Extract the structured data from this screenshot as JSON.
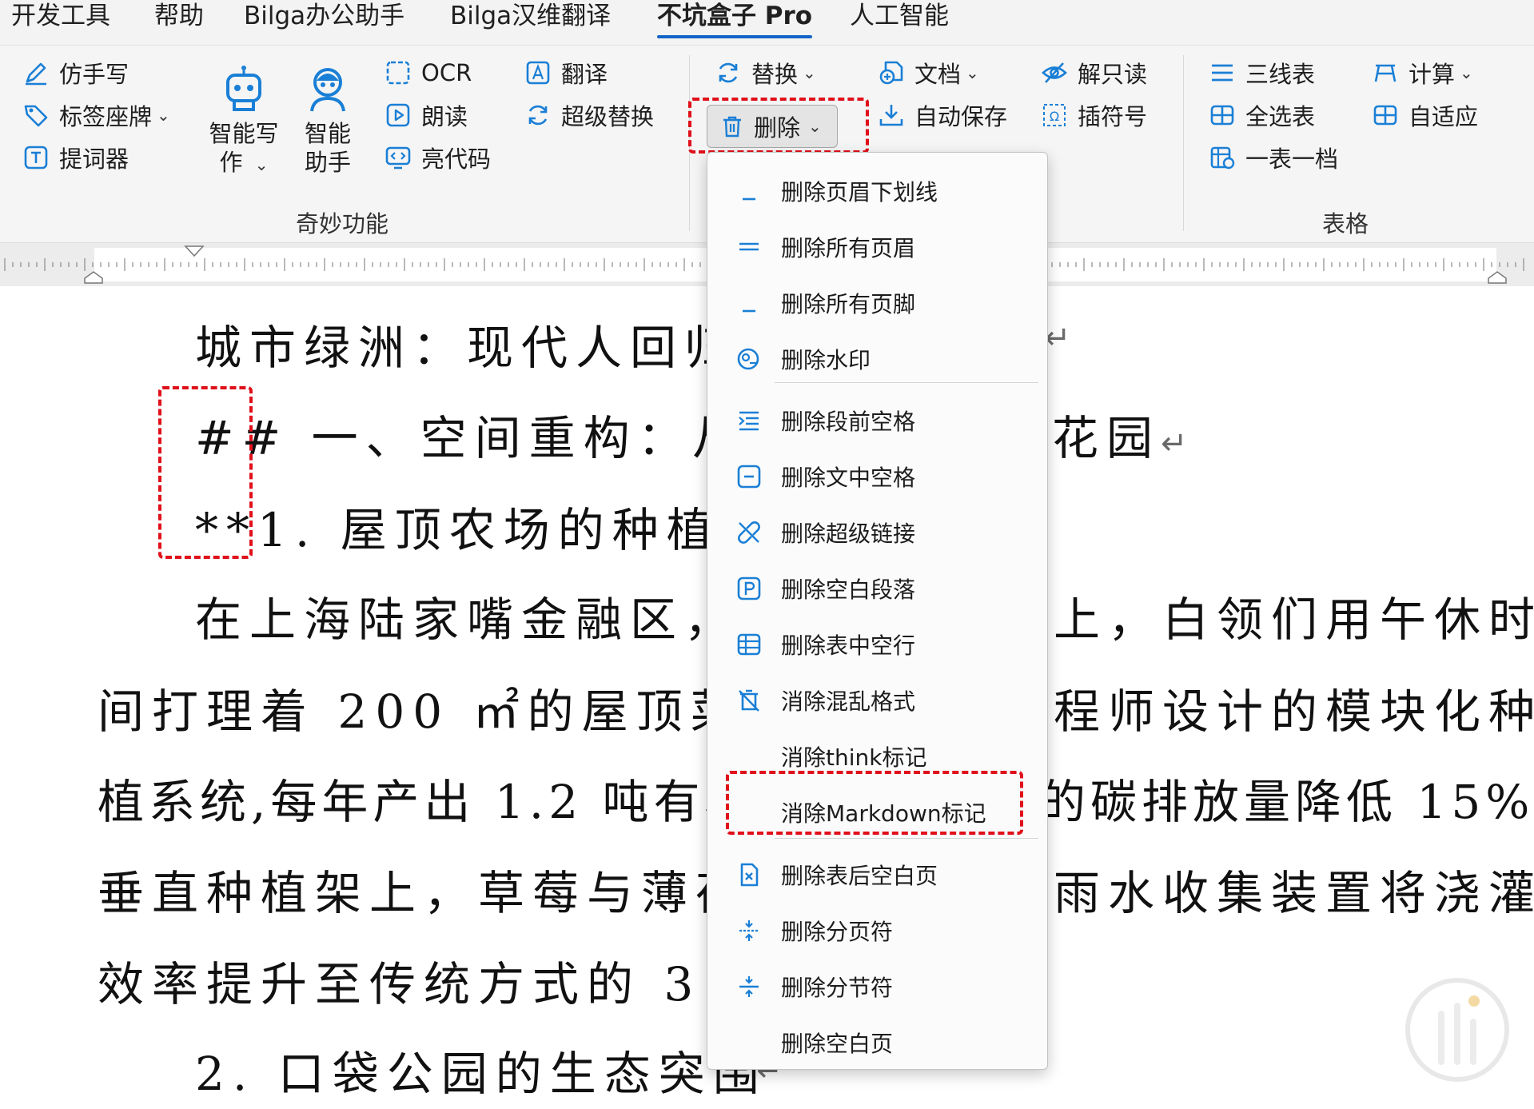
{
  "tabs": [
    {
      "label": "开发工具",
      "active": false
    },
    {
      "label": "帮助",
      "active": false
    },
    {
      "label": "Bilga办公助手",
      "active": false
    },
    {
      "label": "Bilga汉维翻译",
      "active": false
    },
    {
      "label": "不坑盒子 Pro",
      "active": true
    },
    {
      "label": "人工智能",
      "active": false
    }
  ],
  "ribbon": {
    "col1": [
      {
        "label": "仿手写",
        "icon": "pen-icon"
      },
      {
        "label": "标签座牌",
        "icon": "tag-icon",
        "caret": "⌄"
      },
      {
        "label": "提词器",
        "icon": "teleprompter-icon"
      }
    ],
    "smart_write": {
      "line1": "智能写",
      "line2": "作",
      "caret": "⌄",
      "icon": "robot-icon"
    },
    "smart_assistant": {
      "line1": "智能",
      "line2": "助手",
      "icon": "assistant-icon"
    },
    "col3": [
      {
        "label": "OCR",
        "icon": "ocr-icon"
      },
      {
        "label": "朗读",
        "icon": "play-icon"
      },
      {
        "label": "亮代码",
        "icon": "code-icon"
      }
    ],
    "col4": [
      {
        "label": "翻译",
        "icon": "translate-icon"
      },
      {
        "label": "超级替换",
        "icon": "refresh-icon"
      }
    ],
    "group1_label": "奇妙功能",
    "replace": {
      "label": "替换",
      "caret": "⌄"
    },
    "delete": {
      "label": "删除",
      "caret": "⌄"
    },
    "document": {
      "label": "文档",
      "caret": "⌄"
    },
    "autosave": {
      "label": "自动保存"
    },
    "unreadonly": {
      "label": "解只读"
    },
    "insert_symbol": {
      "label": "插符号"
    },
    "table_group": [
      {
        "label": "三线表",
        "icon": "three-line-icon"
      },
      {
        "label": "计算",
        "icon": "calc-icon",
        "caret": "⌄"
      },
      {
        "label": "全选表",
        "icon": "select-table-icon"
      },
      {
        "label": "自适应",
        "icon": "autofit-icon"
      },
      {
        "label": "一表一档",
        "icon": "one-table-icon"
      }
    ],
    "group2_label": "表格"
  },
  "delete_menu": [
    {
      "label": "删除页眉下划线",
      "icon": "underline-icon"
    },
    {
      "label": "删除所有页眉",
      "icon": "header-lines-icon"
    },
    {
      "label": "删除所有页脚",
      "icon": "footer-icon"
    },
    {
      "label": "删除水印",
      "icon": "watermark-icon"
    },
    {
      "label": "删除段前空格",
      "icon": "indent-icon"
    },
    {
      "label": "删除文中空格",
      "icon": "minus-box-icon"
    },
    {
      "label": "删除超级链接",
      "icon": "unlink-icon"
    },
    {
      "label": "删除空白段落",
      "icon": "paragraph-icon"
    },
    {
      "label": "删除表中空行",
      "icon": "table-row-icon"
    },
    {
      "label": "消除混乱格式",
      "icon": "clear-format-icon"
    },
    {
      "label": "消除think标记",
      "icon": ""
    },
    {
      "label": "消除Markdown标记",
      "icon": ""
    },
    {
      "label": "删除表后空白页",
      "icon": "page-x-icon"
    },
    {
      "label": "删除分页符",
      "icon": "page-break-icon"
    },
    {
      "label": "删除分节符",
      "icon": "section-break-icon"
    },
    {
      "label": "删除空白页",
      "icon": ""
    }
  ],
  "document": {
    "line1": "城市绿洲：现代人回归",
    "line2_prefix": "##",
    "line2_a": "一、空间重构：从水",
    "line2_b": "花园",
    "line3_prefix": "**",
    "line3": "1. 屋顶农场的种植革",
    "line4_a": "在上海陆家嘴金融区，3",
    "line4_b": "上，白领们用午休时",
    "line5_a": "间打理着 200 ㎡的屋顶菜园。",
    "line5_b": "程师设计的模块化种",
    "line6_a": "植系统,每年产出 1.2 吨有机",
    "line6_b": "的碳排放量降低 15%。",
    "line7_a": "垂直种植架上，草莓与薄荷",
    "line7_b": "雨水收集装置将浇灌",
    "line8": "效率提升至传统方式的 3 倍。",
    "line9": "2. 口袋公园的生态突围",
    "para_mark": "↵"
  }
}
